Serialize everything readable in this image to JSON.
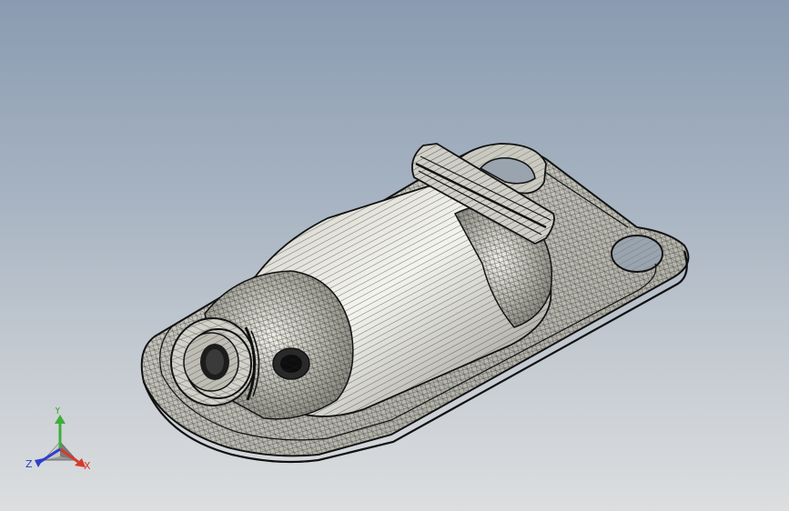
{
  "viewport": {
    "triad": {
      "x_label": "X",
      "y_label": "Y",
      "z_label": "Z",
      "x_color": "#d63a2b",
      "y_color": "#3fae3a",
      "z_color": "#2d3ec9"
    }
  }
}
